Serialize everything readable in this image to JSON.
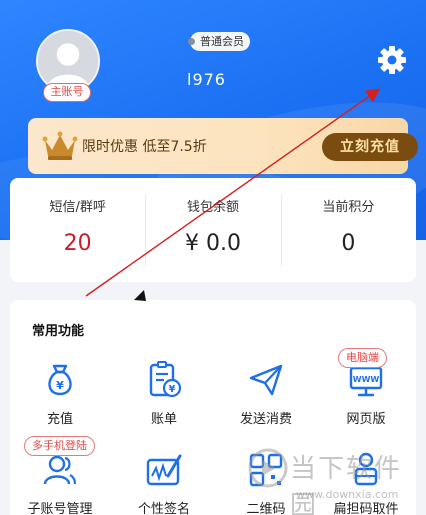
{
  "profile": {
    "account_type": "主账号",
    "member_level": "普通会员",
    "user_id": "l976"
  },
  "promo": {
    "text": "限时优惠 低至7.5折",
    "button": "立刻充值"
  },
  "stats": [
    {
      "label": "短信/群呼",
      "value": "20"
    },
    {
      "label": "钱包余额",
      "value": "¥ 0.0"
    },
    {
      "label": "当前积分",
      "value": "0"
    }
  ],
  "functions": {
    "title": "常用功能",
    "items": [
      {
        "label": "充值",
        "icon": "money-bag-icon"
      },
      {
        "label": "账单",
        "icon": "bill-icon"
      },
      {
        "label": "发送消费",
        "icon": "paper-plane-icon"
      },
      {
        "label": "网页版",
        "icon": "monitor-icon",
        "tag": "电脑端"
      },
      {
        "label": "子账号管理",
        "icon": "users-icon",
        "tag": "多手机登陆"
      },
      {
        "label": "个性签名",
        "icon": "signature-icon"
      },
      {
        "label": "二维码",
        "icon": "qrcode-icon"
      },
      {
        "label": "扁担码取件",
        "icon": "courier-icon"
      }
    ]
  },
  "watermark": {
    "text": "当下软件园",
    "url": "www.downxia.com"
  },
  "colors": {
    "header_blue": "#1a6ff2",
    "accent_red": "#c81e2b",
    "promo_brown": "#7a4c10"
  }
}
